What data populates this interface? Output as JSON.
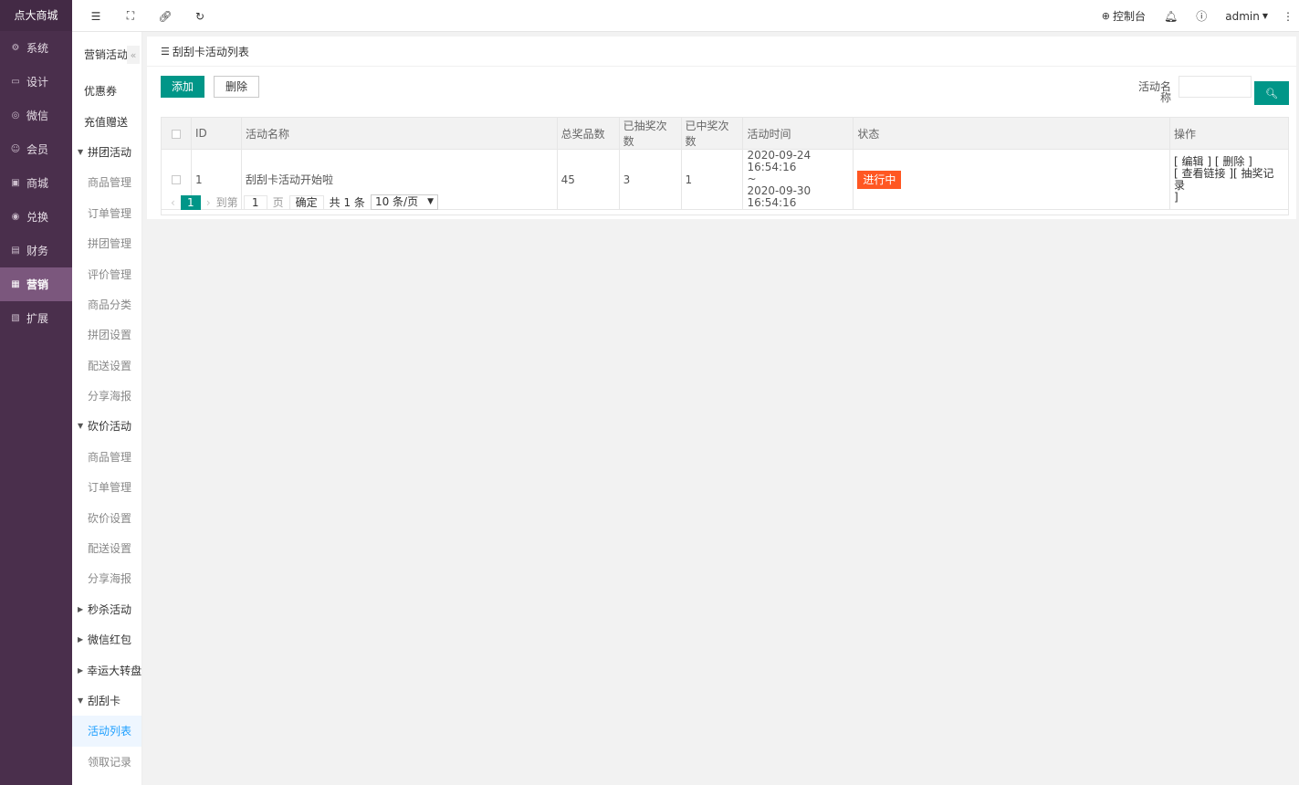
{
  "brand": "点大商城",
  "main_nav": [
    {
      "label": "系统",
      "icon": "gear-icon",
      "glyph": "⚙"
    },
    {
      "label": "设计",
      "icon": "monitor-icon",
      "glyph": "▭"
    },
    {
      "label": "微信",
      "icon": "wechat-icon",
      "glyph": "◎"
    },
    {
      "label": "会员",
      "icon": "user-icon",
      "glyph": "☺"
    },
    {
      "label": "商城",
      "icon": "shop-icon",
      "glyph": "▣"
    },
    {
      "label": "兑换",
      "icon": "exchange-icon",
      "glyph": "◉"
    },
    {
      "label": "财务",
      "icon": "finance-icon",
      "glyph": "▤"
    },
    {
      "label": "营销",
      "icon": "gift-icon",
      "glyph": "▦"
    },
    {
      "label": "扩展",
      "icon": "apps-icon",
      "glyph": "▧"
    }
  ],
  "main_nav_active": "营销",
  "sub_nav": {
    "title": "营销活动",
    "collapse_glyph": "«",
    "items": [
      {
        "type": "top",
        "label": "优惠券"
      },
      {
        "type": "top",
        "label": "充值赠送"
      },
      {
        "type": "group",
        "label": "拼团活动",
        "expanded": true
      },
      {
        "type": "child",
        "label": "商品管理"
      },
      {
        "type": "child",
        "label": "订单管理"
      },
      {
        "type": "child",
        "label": "拼团管理"
      },
      {
        "type": "child",
        "label": "评价管理"
      },
      {
        "type": "child",
        "label": "商品分类"
      },
      {
        "type": "child",
        "label": "拼团设置"
      },
      {
        "type": "child",
        "label": "配送设置"
      },
      {
        "type": "child",
        "label": "分享海报"
      },
      {
        "type": "group",
        "label": "砍价活动",
        "expanded": true
      },
      {
        "type": "child",
        "label": "商品管理"
      },
      {
        "type": "child",
        "label": "订单管理"
      },
      {
        "type": "child",
        "label": "砍价设置"
      },
      {
        "type": "child",
        "label": "配送设置"
      },
      {
        "type": "child",
        "label": "分享海报"
      },
      {
        "type": "group",
        "label": "秒杀活动",
        "expanded": false
      },
      {
        "type": "group",
        "label": "微信红包",
        "expanded": false
      },
      {
        "type": "group",
        "label": "幸运大转盘",
        "expanded": false
      },
      {
        "type": "group",
        "label": "刮刮卡",
        "expanded": true
      },
      {
        "type": "child",
        "label": "活动列表",
        "selected": true
      },
      {
        "type": "child",
        "label": "领取记录"
      }
    ]
  },
  "topbar": {
    "console_label": "控制台",
    "user_label": "admin"
  },
  "panel": {
    "title": "刮刮卡活动列表",
    "add_label": "添加",
    "delete_label": "删除",
    "search_label": "活动名称",
    "search_value": ""
  },
  "table": {
    "columns": [
      "ID",
      "活动名称",
      "总奖品数",
      "已抽奖次数",
      "已中奖次数",
      "活动时间",
      "状态",
      "操作"
    ],
    "rows": [
      {
        "id": "1",
        "name": "刮刮卡活动开始啦",
        "total_prizes": "45",
        "draw_count": "3",
        "win_count": "1",
        "start_time": "2020-09-24 16:54:16",
        "range_sep": "~",
        "end_time": "2020-09-30 16:54:16",
        "status": "进行中",
        "ops_line1": "[ 编辑 ] [ 删除 ]",
        "ops_line2": "[ 查看链接 ][ 抽奖记录",
        "ops_line3": "]"
      }
    ]
  },
  "pager": {
    "current": "1",
    "goto_label": "到第",
    "goto_value": "1",
    "page_unit": "页",
    "ok_label": "确定",
    "total_label": "共 1 条",
    "page_size": "10 条/页"
  },
  "colors": {
    "sidebar_bg": "#4a2f4c",
    "sidebar_active": "#7b577d",
    "primary": "#009688",
    "status_running": "#ff5722"
  }
}
